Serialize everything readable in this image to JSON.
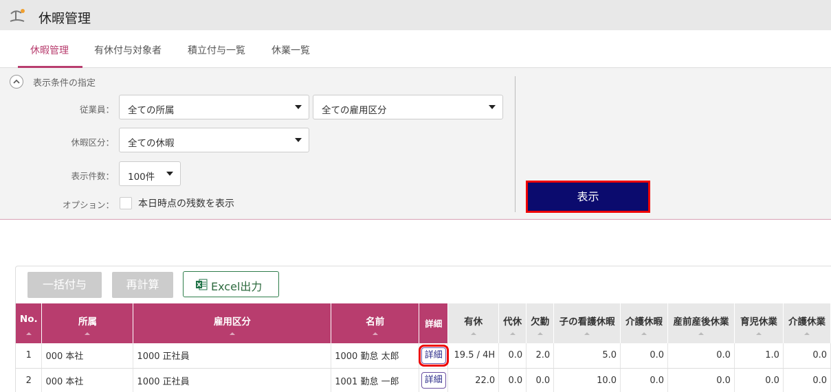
{
  "app": {
    "title": "休暇管理",
    "icon": "beach-umbrella-icon"
  },
  "tabs": [
    {
      "label": "休暇管理",
      "active": true
    },
    {
      "label": "有休付与対象者",
      "active": false
    },
    {
      "label": "積立付与一覧",
      "active": false
    },
    {
      "label": "休業一覧",
      "active": false
    }
  ],
  "filter": {
    "title": "表示条件の指定",
    "employee_label": "従業員：",
    "department_value": "全ての所属",
    "employment_value": "全ての雇用区分",
    "leave_type_label": "休暇区分：",
    "leave_type_value": "全ての休暇",
    "count_label": "表示件数：",
    "count_value": "100件",
    "option_label": "オプション：",
    "option_checkbox_label": "本日時点の残数を表示",
    "option_checked": false,
    "show_button": "表示"
  },
  "actions": {
    "bulk_grant": "一括付与",
    "recalc": "再計算",
    "excel": "Excel出力"
  },
  "table": {
    "headers": [
      "No.",
      "所属",
      "雇用区分",
      "名前",
      "詳細",
      "有休",
      "代休",
      "欠勤",
      "子の看護休暇",
      "介護休暇",
      "産前産後休業",
      "育児休業",
      "介護休業"
    ],
    "rows": [
      [
        "1",
        "000 本社",
        "1000 正社員",
        "1000 勤怠 太郎",
        "詳細",
        "19.5 / 4H",
        "0.0",
        "2.0",
        "5.0",
        "0.0",
        "0.0",
        "1.0",
        "0.0"
      ],
      [
        "2",
        "000 本社",
        "1000 正社員",
        "1001 勤怠 一郎",
        "詳細",
        "22.0",
        "0.0",
        "0.0",
        "10.0",
        "0.0",
        "0.0",
        "0.0",
        "0.0"
      ]
    ]
  },
  "colors": {
    "accent": "#b83d6e",
    "primary_button": "#0b0b6e",
    "highlight": "#e00000",
    "excel": "#2e7d4a"
  }
}
